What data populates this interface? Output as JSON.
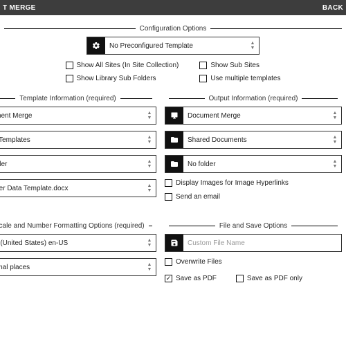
{
  "topbar": {
    "title_left": "T MERGE",
    "back": "BACK"
  },
  "sections": {
    "config": "Configuration Options",
    "template": "Template Information (required)",
    "output": "Output Information (required)",
    "locale": "Locale and Number Formatting Options (required)",
    "filesave": "File and Save Options"
  },
  "config": {
    "template_select": "No Preconfigured Template",
    "checks": {
      "show_all_sites": "Show All Sites (In Site Collection)",
      "show_library_sub": "Show Library Sub Folders",
      "show_sub_sites": "Show Sub Sites",
      "use_multiple": "Use multiple templates"
    }
  },
  "template": {
    "source": "ocument Merge",
    "library": "DM_Templates",
    "folder": "o folder",
    "file": "stomer Data Template.docx"
  },
  "output": {
    "target": "Document Merge",
    "library": "Shared Documents",
    "folder": "No folder",
    "display_images": "Display Images for Image Hyperlinks",
    "send_email": "Send an email"
  },
  "locale": {
    "lang": "glish (United States) en-US",
    "decimals": "decimal places"
  },
  "filesave": {
    "filename_placeholder": "Custom File Name",
    "overwrite": "Overwrite Files",
    "save_pdf": "Save as PDF",
    "save_pdf_only": "Save as PDF only"
  }
}
